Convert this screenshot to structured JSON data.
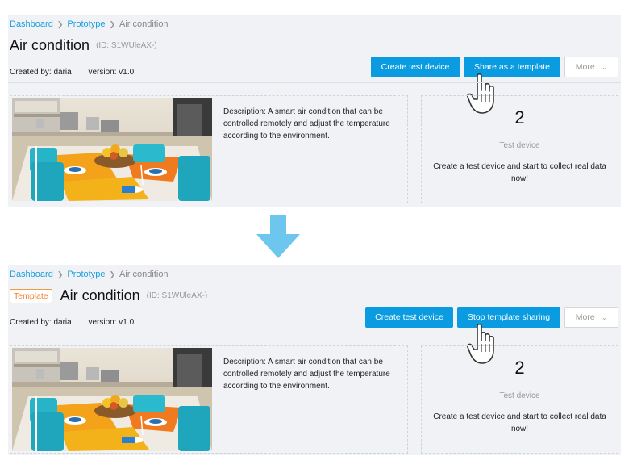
{
  "breadcrumb": {
    "items": [
      "Dashboard",
      "Prototype",
      "Air condition"
    ]
  },
  "device": {
    "title": "Air condition",
    "id": "(ID: S1WUleAX-)",
    "created_by": "Created by: daria",
    "version": "version: v1.0",
    "description": "Description: A smart air condition that can be controlled remotely and adjust the temperature according to the environment.",
    "test_device_count": "2",
    "test_device_label": "Test device",
    "test_device_cta": "Create a test device and start to collect real data now!"
  },
  "before": {
    "buttons": {
      "create": "Create test device",
      "share": "Share as a template",
      "more": "More"
    }
  },
  "after": {
    "template_tag": "Template",
    "buttons": {
      "create": "Create test device",
      "stop": "Stop template sharing",
      "more": "More"
    }
  },
  "colors": {
    "primary": "#0a9be0",
    "link": "#1a9fe0",
    "tag": "#f0832a",
    "arrow": "#6cc6ee",
    "panel_bg": "#f1f2f5"
  },
  "icons": [
    "chevron-right-icon",
    "chevron-down-icon",
    "pointing-hand-cursor-icon",
    "down-arrow-icon"
  ]
}
